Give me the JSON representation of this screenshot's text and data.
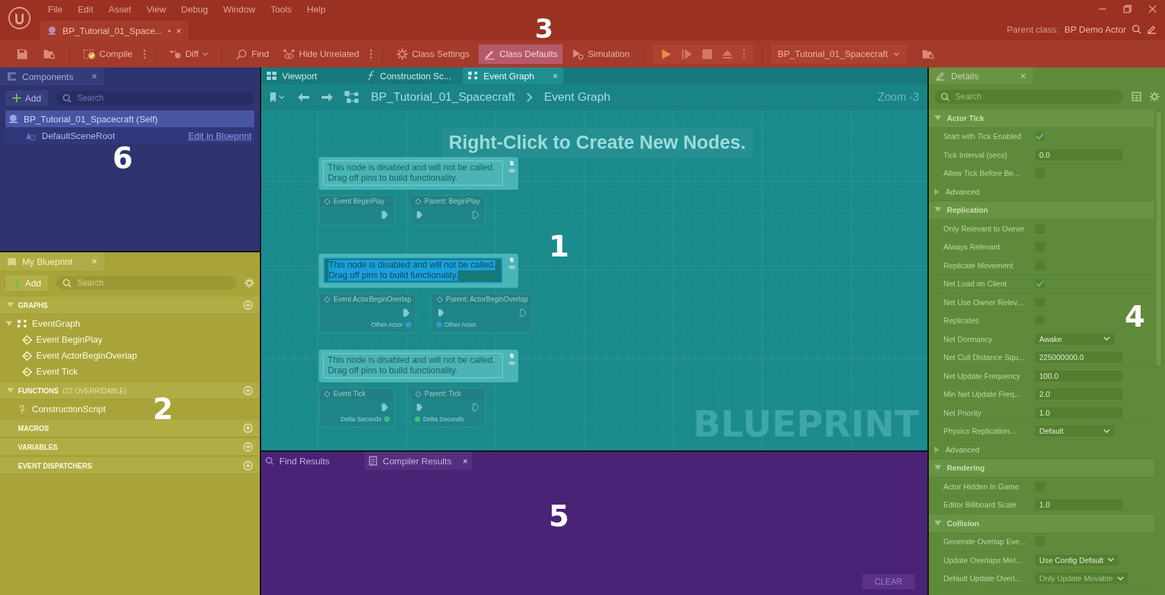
{
  "menu": [
    "File",
    "Edit",
    "Asset",
    "View",
    "Debug",
    "Window",
    "Tools",
    "Help"
  ],
  "document_tab": {
    "label": "BP_Tutorial_01_Space...",
    "modified_mark": "•",
    "close": "×"
  },
  "parent_class": {
    "label": "Parent class:",
    "value": "BP Demo Actor"
  },
  "toolbar": [
    {
      "label": "Compile",
      "selected": false
    },
    {
      "label": "Diff",
      "selected": false
    },
    {
      "label": "Find",
      "selected": false
    },
    {
      "label": "Hide Unrelated",
      "selected": false
    },
    {
      "label": "Class Settings",
      "selected": false
    },
    {
      "label": "Class Defaults",
      "selected": true
    },
    {
      "label": "Simulation",
      "selected": false
    }
  ],
  "debug_object": "BP_Tutorial_01_Spacecraft",
  "header_region_label": "3",
  "components": {
    "tab": "Components",
    "close": "×",
    "add": "Add",
    "search_placeholder": "Search",
    "region_label": "6",
    "tree": [
      {
        "label": "BP_Tutorial_01_Spacecraft (Self)",
        "selected": true,
        "children": [
          {
            "label": "DefaultSceneRoot",
            "selected": false,
            "link": "Edit in Blueprint"
          }
        ]
      }
    ]
  },
  "my_blueprint": {
    "tab": "My Blueprint",
    "close": "×",
    "add": "Add",
    "search_placeholder": "Search",
    "region_label": "2",
    "sections": [
      {
        "title": "GRAPHS",
        "expanded": true,
        "items": [
          {
            "label": "EventGraph",
            "expanded": true,
            "children": [
              {
                "label": "Event BeginPlay"
              },
              {
                "label": "Event ActorBeginOverlap"
              },
              {
                "label": "Event Tick"
              }
            ]
          }
        ]
      },
      {
        "title": "FUNCTIONS",
        "note": "(22 OVERRIDABLE)",
        "expanded": true,
        "items": [
          {
            "label": "ConstructionScript"
          }
        ]
      },
      {
        "title": "MACROS",
        "expanded": false
      },
      {
        "title": "VARIABLES",
        "expanded": false
      },
      {
        "title": "EVENT DISPATCHERS",
        "expanded": false
      }
    ]
  },
  "graph": {
    "tabs": [
      {
        "label": "Viewport",
        "selected": false
      },
      {
        "label": "Construction Sc...",
        "selected": false
      },
      {
        "label": "Event Graph",
        "selected": true,
        "close": "×"
      }
    ],
    "breadcrumb": [
      "BP_Tutorial_01_Spacecraft",
      "Event Graph"
    ],
    "zoom": "Zoom -3",
    "hint": "Right-Click to Create New Nodes.",
    "watermark": "BLUEPRINT",
    "region_label": "1",
    "groups": [
      {
        "comment": [
          "This node is disabled and will not be called.",
          "Drag off pins to build functionality."
        ],
        "selected": false,
        "nodes": [
          {
            "title": "Event BeginPlay"
          },
          {
            "title": "Parent: BeginPlay"
          }
        ]
      },
      {
        "comment": [
          "This node is disabled and will not be called.",
          "Drag off pins to build functionality."
        ],
        "selected": true,
        "nodes": [
          {
            "title": "Event ActorBeginOverlap",
            "pin": "Other Actor"
          },
          {
            "title": "Parent: ActorBeginOverlap",
            "pin": "Other Actor"
          }
        ]
      },
      {
        "comment": [
          "This node is disabled and will not be called.",
          "Drag off pins to build functionality."
        ],
        "selected": false,
        "nodes": [
          {
            "title": "Event Tick",
            "pin": "Delta Seconds"
          },
          {
            "title": "Parent: Tick",
            "pin": "Delta Seconds"
          }
        ]
      }
    ]
  },
  "results": {
    "tabs": [
      {
        "label": "Find Results",
        "selected": false
      },
      {
        "label": "Compiler Results",
        "selected": true,
        "close": "×"
      }
    ],
    "clear": "CLEAR",
    "region_label": "5"
  },
  "details": {
    "tab": "Details",
    "close": "×",
    "search_placeholder": "Search",
    "region_label": "4",
    "rows": [
      {
        "kind": "section",
        "label": "Actor Tick"
      },
      {
        "kind": "checkbox",
        "label": "Start with Tick Enabled",
        "checked": true
      },
      {
        "kind": "number",
        "label": "Tick Interval (secs)",
        "value": "0.0"
      },
      {
        "kind": "checkbox",
        "label": "Allow Tick Before Be...",
        "checked": false
      },
      {
        "kind": "group",
        "label": "Advanced"
      },
      {
        "kind": "section",
        "label": "Replication"
      },
      {
        "kind": "checkbox",
        "label": "Only Relevant to Owner",
        "checked": false
      },
      {
        "kind": "checkbox",
        "label": "Always Relevant",
        "checked": false
      },
      {
        "kind": "checkbox",
        "label": "Replicate Movement",
        "checked": false
      },
      {
        "kind": "checkbox",
        "label": "Net Load on Client",
        "checked": true
      },
      {
        "kind": "checkbox",
        "label": "Net Use Owner Relev...",
        "checked": false
      },
      {
        "kind": "checkbox",
        "label": "Replicates",
        "checked": false
      },
      {
        "kind": "dropdown",
        "label": "Net Dormancy",
        "value": "Awake",
        "disabled": false
      },
      {
        "kind": "number",
        "label": "Net Cull Distance Squ...",
        "value": "225000000.0"
      },
      {
        "kind": "number",
        "label": "Net Update Frequency",
        "value": "100.0"
      },
      {
        "kind": "number",
        "label": "Min Net Update Freq...",
        "value": "2.0"
      },
      {
        "kind": "number",
        "label": "Net Priority",
        "value": "1.0"
      },
      {
        "kind": "dropdown",
        "label": "Physics Replication...",
        "value": "Default",
        "disabled": false
      },
      {
        "kind": "group",
        "label": "Advanced"
      },
      {
        "kind": "section",
        "label": "Rendering"
      },
      {
        "kind": "checkbox",
        "label": "Actor Hidden In Game",
        "checked": false
      },
      {
        "kind": "number",
        "label": "Editor Billboard Scale",
        "value": "1.0"
      },
      {
        "kind": "section",
        "label": "Collision"
      },
      {
        "kind": "checkbox",
        "label": "Generate Overlap Eve...",
        "checked": false
      },
      {
        "kind": "dropdown",
        "label": "Update Overlaps Met...",
        "value": "Use Config Default",
        "disabled": false
      },
      {
        "kind": "dropdown",
        "label": "Default Update Overl...",
        "value": "Only Update Movable",
        "disabled": true
      }
    ]
  }
}
